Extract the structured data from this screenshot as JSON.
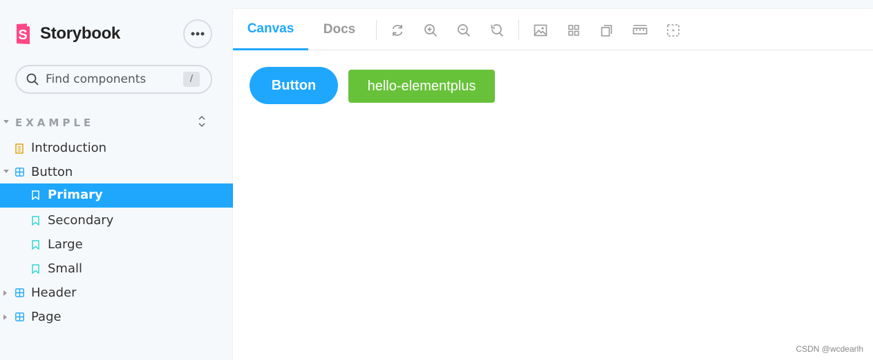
{
  "brand": {
    "name": "Storybook",
    "logo_letter": "S",
    "accent": "#ff4785"
  },
  "sidebar": {
    "search": {
      "placeholder": "Find components",
      "shortcut": "/"
    },
    "section": {
      "title": "EXAMPLE"
    },
    "items": [
      {
        "label": "Introduction",
        "icon": "document-icon"
      },
      {
        "label": "Button",
        "icon": "component-icon"
      },
      {
        "label": "Primary",
        "icon": "bookmark-icon",
        "selected": true
      },
      {
        "label": "Secondary",
        "icon": "bookmark-icon"
      },
      {
        "label": "Large",
        "icon": "bookmark-icon"
      },
      {
        "label": "Small",
        "icon": "bookmark-icon"
      },
      {
        "label": "Header",
        "icon": "component-icon"
      },
      {
        "label": "Page",
        "icon": "component-icon"
      }
    ]
  },
  "toolbar": {
    "tabs": [
      {
        "label": "Canvas",
        "active": true
      },
      {
        "label": "Docs",
        "active": false
      }
    ],
    "icons": [
      "refresh-icon",
      "zoom-in-icon",
      "zoom-out-icon",
      "zoom-reset-icon",
      "background-icon",
      "grid-icon",
      "viewport-icon",
      "measure-icon",
      "outline-icon"
    ]
  },
  "canvas": {
    "primary_button": "Button",
    "element_button": "hello-elementplus"
  },
  "colors": {
    "primary": "#1ea7fd",
    "success": "#67c23a",
    "sidebar_bg": "#f6f9fc"
  },
  "watermark": "CSDN @wcdearlh"
}
